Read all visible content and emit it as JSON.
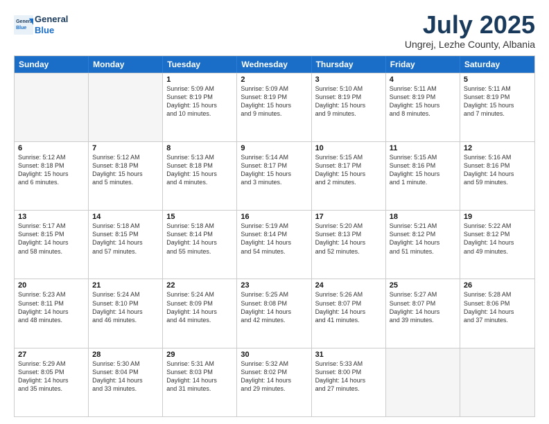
{
  "header": {
    "logo_line1": "General",
    "logo_line2": "Blue",
    "month_title": "July 2025",
    "subtitle": "Ungrej, Lezhe County, Albania"
  },
  "weekdays": [
    "Sunday",
    "Monday",
    "Tuesday",
    "Wednesday",
    "Thursday",
    "Friday",
    "Saturday"
  ],
  "rows": [
    [
      {
        "day": "",
        "lines": []
      },
      {
        "day": "",
        "lines": []
      },
      {
        "day": "1",
        "lines": [
          "Sunrise: 5:09 AM",
          "Sunset: 8:19 PM",
          "Daylight: 15 hours",
          "and 10 minutes."
        ]
      },
      {
        "day": "2",
        "lines": [
          "Sunrise: 5:09 AM",
          "Sunset: 8:19 PM",
          "Daylight: 15 hours",
          "and 9 minutes."
        ]
      },
      {
        "day": "3",
        "lines": [
          "Sunrise: 5:10 AM",
          "Sunset: 8:19 PM",
          "Daylight: 15 hours",
          "and 9 minutes."
        ]
      },
      {
        "day": "4",
        "lines": [
          "Sunrise: 5:11 AM",
          "Sunset: 8:19 PM",
          "Daylight: 15 hours",
          "and 8 minutes."
        ]
      },
      {
        "day": "5",
        "lines": [
          "Sunrise: 5:11 AM",
          "Sunset: 8:19 PM",
          "Daylight: 15 hours",
          "and 7 minutes."
        ]
      }
    ],
    [
      {
        "day": "6",
        "lines": [
          "Sunrise: 5:12 AM",
          "Sunset: 8:18 PM",
          "Daylight: 15 hours",
          "and 6 minutes."
        ]
      },
      {
        "day": "7",
        "lines": [
          "Sunrise: 5:12 AM",
          "Sunset: 8:18 PM",
          "Daylight: 15 hours",
          "and 5 minutes."
        ]
      },
      {
        "day": "8",
        "lines": [
          "Sunrise: 5:13 AM",
          "Sunset: 8:18 PM",
          "Daylight: 15 hours",
          "and 4 minutes."
        ]
      },
      {
        "day": "9",
        "lines": [
          "Sunrise: 5:14 AM",
          "Sunset: 8:17 PM",
          "Daylight: 15 hours",
          "and 3 minutes."
        ]
      },
      {
        "day": "10",
        "lines": [
          "Sunrise: 5:15 AM",
          "Sunset: 8:17 PM",
          "Daylight: 15 hours",
          "and 2 minutes."
        ]
      },
      {
        "day": "11",
        "lines": [
          "Sunrise: 5:15 AM",
          "Sunset: 8:16 PM",
          "Daylight: 15 hours",
          "and 1 minute."
        ]
      },
      {
        "day": "12",
        "lines": [
          "Sunrise: 5:16 AM",
          "Sunset: 8:16 PM",
          "Daylight: 14 hours",
          "and 59 minutes."
        ]
      }
    ],
    [
      {
        "day": "13",
        "lines": [
          "Sunrise: 5:17 AM",
          "Sunset: 8:15 PM",
          "Daylight: 14 hours",
          "and 58 minutes."
        ]
      },
      {
        "day": "14",
        "lines": [
          "Sunrise: 5:18 AM",
          "Sunset: 8:15 PM",
          "Daylight: 14 hours",
          "and 57 minutes."
        ]
      },
      {
        "day": "15",
        "lines": [
          "Sunrise: 5:18 AM",
          "Sunset: 8:14 PM",
          "Daylight: 14 hours",
          "and 55 minutes."
        ]
      },
      {
        "day": "16",
        "lines": [
          "Sunrise: 5:19 AM",
          "Sunset: 8:14 PM",
          "Daylight: 14 hours",
          "and 54 minutes."
        ]
      },
      {
        "day": "17",
        "lines": [
          "Sunrise: 5:20 AM",
          "Sunset: 8:13 PM",
          "Daylight: 14 hours",
          "and 52 minutes."
        ]
      },
      {
        "day": "18",
        "lines": [
          "Sunrise: 5:21 AM",
          "Sunset: 8:12 PM",
          "Daylight: 14 hours",
          "and 51 minutes."
        ]
      },
      {
        "day": "19",
        "lines": [
          "Sunrise: 5:22 AM",
          "Sunset: 8:12 PM",
          "Daylight: 14 hours",
          "and 49 minutes."
        ]
      }
    ],
    [
      {
        "day": "20",
        "lines": [
          "Sunrise: 5:23 AM",
          "Sunset: 8:11 PM",
          "Daylight: 14 hours",
          "and 48 minutes."
        ]
      },
      {
        "day": "21",
        "lines": [
          "Sunrise: 5:24 AM",
          "Sunset: 8:10 PM",
          "Daylight: 14 hours",
          "and 46 minutes."
        ]
      },
      {
        "day": "22",
        "lines": [
          "Sunrise: 5:24 AM",
          "Sunset: 8:09 PM",
          "Daylight: 14 hours",
          "and 44 minutes."
        ]
      },
      {
        "day": "23",
        "lines": [
          "Sunrise: 5:25 AM",
          "Sunset: 8:08 PM",
          "Daylight: 14 hours",
          "and 42 minutes."
        ]
      },
      {
        "day": "24",
        "lines": [
          "Sunrise: 5:26 AM",
          "Sunset: 8:07 PM",
          "Daylight: 14 hours",
          "and 41 minutes."
        ]
      },
      {
        "day": "25",
        "lines": [
          "Sunrise: 5:27 AM",
          "Sunset: 8:07 PM",
          "Daylight: 14 hours",
          "and 39 minutes."
        ]
      },
      {
        "day": "26",
        "lines": [
          "Sunrise: 5:28 AM",
          "Sunset: 8:06 PM",
          "Daylight: 14 hours",
          "and 37 minutes."
        ]
      }
    ],
    [
      {
        "day": "27",
        "lines": [
          "Sunrise: 5:29 AM",
          "Sunset: 8:05 PM",
          "Daylight: 14 hours",
          "and 35 minutes."
        ]
      },
      {
        "day": "28",
        "lines": [
          "Sunrise: 5:30 AM",
          "Sunset: 8:04 PM",
          "Daylight: 14 hours",
          "and 33 minutes."
        ]
      },
      {
        "day": "29",
        "lines": [
          "Sunrise: 5:31 AM",
          "Sunset: 8:03 PM",
          "Daylight: 14 hours",
          "and 31 minutes."
        ]
      },
      {
        "day": "30",
        "lines": [
          "Sunrise: 5:32 AM",
          "Sunset: 8:02 PM",
          "Daylight: 14 hours",
          "and 29 minutes."
        ]
      },
      {
        "day": "31",
        "lines": [
          "Sunrise: 5:33 AM",
          "Sunset: 8:00 PM",
          "Daylight: 14 hours",
          "and 27 minutes."
        ]
      },
      {
        "day": "",
        "lines": []
      },
      {
        "day": "",
        "lines": []
      }
    ]
  ]
}
